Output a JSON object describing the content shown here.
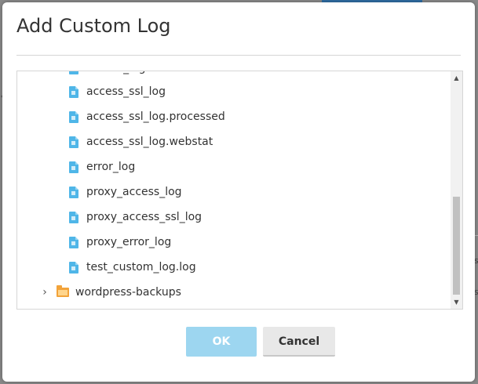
{
  "dialog": {
    "title": "Add Custom Log",
    "ok_label": "OK",
    "cancel_label": "Cancel"
  },
  "tree": {
    "partial_item": "access_log",
    "files": [
      "access_ssl_log",
      "access_ssl_log.processed",
      "access_ssl_log.webstat",
      "error_log",
      "proxy_access_log",
      "proxy_access_ssl_log",
      "proxy_error_log",
      "test_custom_log.log"
    ],
    "folder": {
      "label": "wordpress-backups",
      "expanded": false
    }
  },
  "icons": {
    "file": "file-icon",
    "folder": "folder-icon",
    "expander": "chevron-right-icon",
    "scroll_up": "scroll-up-arrow-icon",
    "scroll_down": "scroll-down-arrow-icon"
  },
  "background": {
    "right_edge_letter": "s"
  },
  "colors": {
    "ok_button": "#9dd6f0",
    "file_icon": "#4fb6e8",
    "folder_icon": "#f2a33a"
  }
}
